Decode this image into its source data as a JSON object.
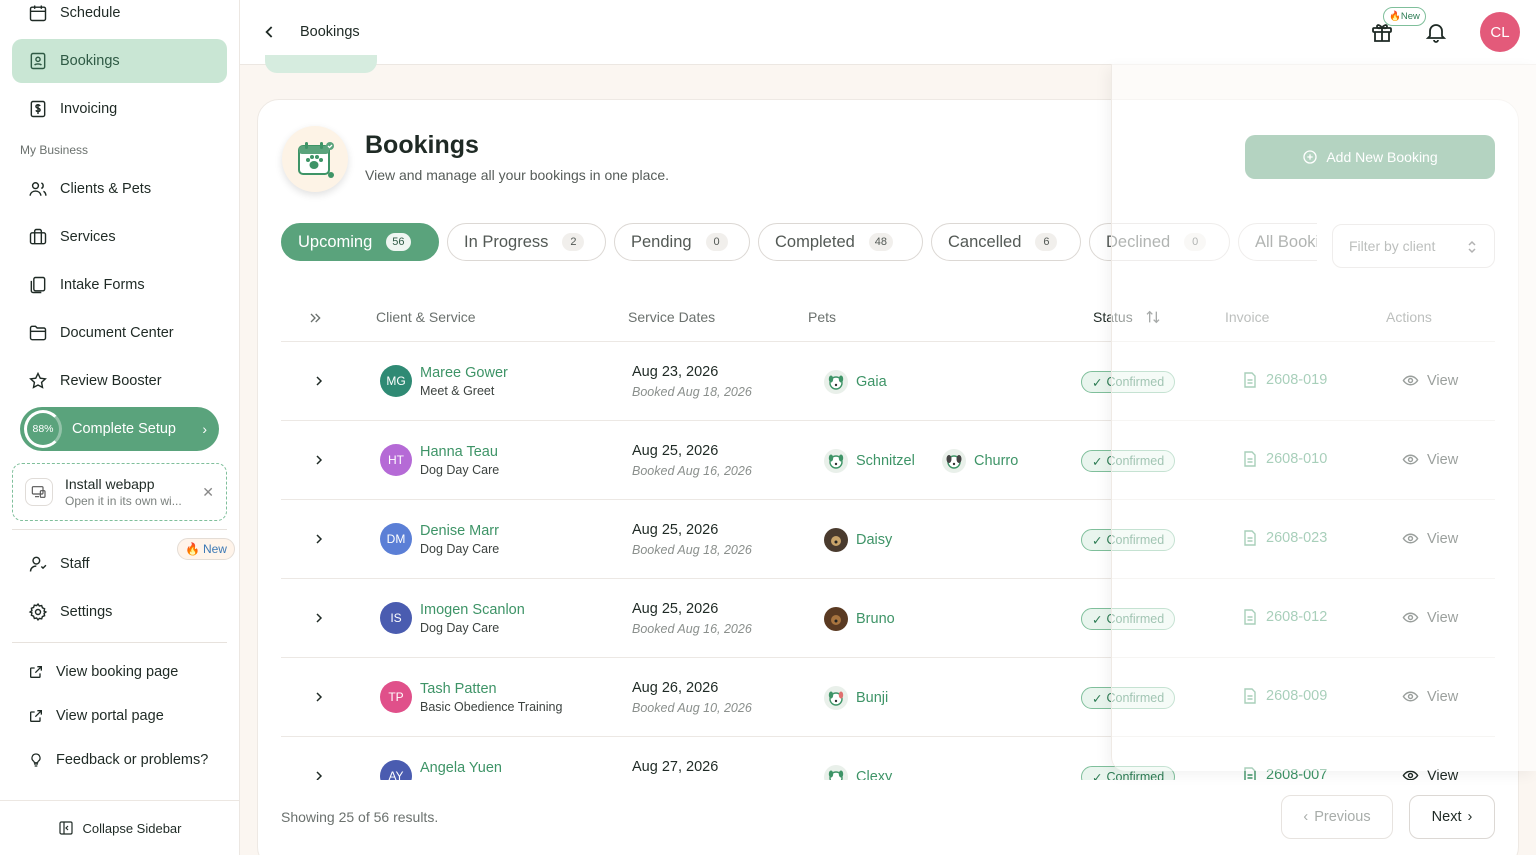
{
  "sidebar": {
    "items_top": [
      {
        "label": "Schedule",
        "icon": "calendar-icon"
      },
      {
        "label": "Bookings",
        "icon": "booking-icon",
        "active": true
      },
      {
        "label": "Invoicing",
        "icon": "invoice-dollar-icon"
      }
    ],
    "section_label": "My Business",
    "items_business": [
      {
        "label": "Clients & Pets",
        "icon": "users-icon"
      },
      {
        "label": "Services",
        "icon": "briefcase-icon"
      },
      {
        "label": "Intake Forms",
        "icon": "files-icon"
      },
      {
        "label": "Document Center",
        "icon": "folder-icon"
      },
      {
        "label": "Review Booster",
        "icon": "star-icon"
      }
    ],
    "setup": {
      "percent": "88%",
      "label": "Complete Setup"
    },
    "install": {
      "title": "Install webapp",
      "subtitle": "Open it in its own wi..."
    },
    "items_bottom": [
      {
        "label": "Staff",
        "icon": "staff-icon",
        "badge": "New"
      },
      {
        "label": "Settings",
        "icon": "gear-icon"
      }
    ],
    "links": [
      {
        "label": "View booking page",
        "icon": "external-link-icon"
      },
      {
        "label": "View portal page",
        "icon": "external-link-icon"
      },
      {
        "label": "Feedback or problems?",
        "icon": "lightbulb-icon"
      }
    ],
    "collapse_label": "Collapse Sidebar"
  },
  "header": {
    "breadcrumb": "Bookings",
    "gift_badge": "New",
    "avatar_initials": "CL"
  },
  "page": {
    "title": "Bookings",
    "subtitle": "View and manage all your bookings in one place.",
    "add_button": "Add New Booking",
    "filter_placeholder": "Filter by client"
  },
  "tabs": [
    {
      "label": "Upcoming",
      "count": "56",
      "active": true
    },
    {
      "label": "In Progress",
      "count": "2"
    },
    {
      "label": "Pending",
      "count": "0"
    },
    {
      "label": "Completed",
      "count": "48"
    },
    {
      "label": "Cancelled",
      "count": "6"
    },
    {
      "label": "Declined",
      "count": "0"
    },
    {
      "label": "All Bookings",
      "count": ""
    }
  ],
  "table": {
    "columns": [
      "Client & Service",
      "Service Dates",
      "Pets",
      "Status",
      "Invoice",
      "Actions"
    ],
    "rows": [
      {
        "initials": "MG",
        "avatar_color": "#2f8a74",
        "client": "Maree Gower",
        "service": "Meet & Greet",
        "date": "Aug 23, 2026",
        "booked": "Booked Aug 18, 2026",
        "pets": [
          "Gaia"
        ],
        "status": "Confirmed",
        "invoice": "2608-019",
        "action": "View"
      },
      {
        "initials": "HT",
        "avatar_color": "#b56ad6",
        "client": "Hanna Teau",
        "service": "Dog Day Care",
        "date": "Aug 25, 2026",
        "booked": "Booked Aug 16, 2026",
        "pets": [
          "Schnitzel",
          "Churro"
        ],
        "status": "Confirmed",
        "invoice": "2608-010",
        "action": "View"
      },
      {
        "initials": "DM",
        "avatar_color": "#5b7fd6",
        "client": "Denise Marr",
        "service": "Dog Day Care",
        "date": "Aug 25, 2026",
        "booked": "Booked Aug 18, 2026",
        "pets": [
          "Daisy"
        ],
        "status": "Confirmed",
        "invoice": "2608-023",
        "action": "View"
      },
      {
        "initials": "IS",
        "avatar_color": "#4a5cb0",
        "client": "Imogen Scanlon",
        "service": "Dog Day Care",
        "date": "Aug 25, 2026",
        "booked": "Booked Aug 16, 2026",
        "pets": [
          "Bruno"
        ],
        "status": "Confirmed",
        "invoice": "2608-012",
        "action": "View"
      },
      {
        "initials": "TP",
        "avatar_color": "#e0508a",
        "client": "Tash Patten",
        "service": "Basic Obedience Training",
        "date": "Aug 26, 2026",
        "booked": "Booked Aug 10, 2026",
        "pets": [
          "Bunji"
        ],
        "status": "Confirmed",
        "invoice": "2608-009",
        "action": "View"
      },
      {
        "initials": "AY",
        "avatar_color": "#4a5cb0",
        "client": "Angela Yuen",
        "service": "",
        "date": "Aug 27, 2026",
        "booked": "",
        "pets": [
          "Clexy"
        ],
        "status": "Confirmed",
        "invoice": "2608-007",
        "action": "View"
      }
    ]
  },
  "footer": {
    "showing": "Showing 25 of 56 results.",
    "previous": "Previous",
    "next": "Next"
  },
  "colors": {
    "accent": "#5aa37c",
    "accent_text": "#3e9467",
    "active_nav_bg": "#c9e6d4"
  }
}
